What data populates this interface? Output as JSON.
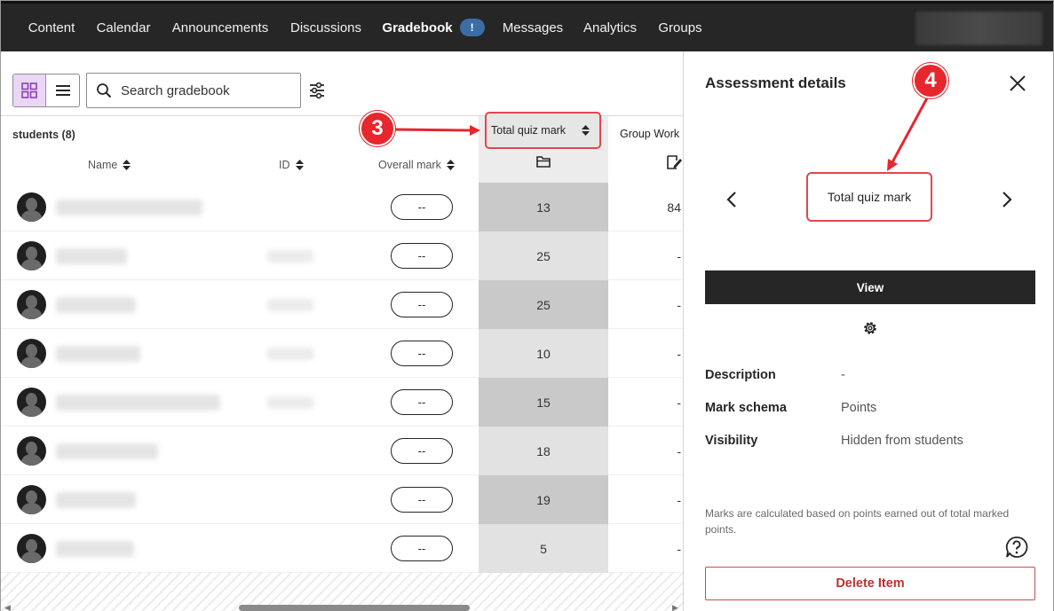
{
  "nav": {
    "tabs": [
      {
        "label": "Content"
      },
      {
        "label": "Calendar"
      },
      {
        "label": "Announcements"
      },
      {
        "label": "Discussions"
      },
      {
        "label": "Gradebook",
        "badge": "!"
      },
      {
        "label": "Messages"
      },
      {
        "label": "Analytics"
      },
      {
        "label": "Groups"
      }
    ],
    "active": "Gradebook"
  },
  "toolbar": {
    "search_placeholder": "Search gradebook"
  },
  "grid": {
    "students_label": "students (8)",
    "columns": {
      "name": "Name",
      "id": "ID",
      "overall": "Overall mark",
      "quiz": "Total quiz mark",
      "group": "Group Work"
    },
    "rows": [
      {
        "overall": "--",
        "quiz": "13",
        "group": "84"
      },
      {
        "overall": "--",
        "quiz": "25",
        "group": "-"
      },
      {
        "overall": "--",
        "quiz": "25",
        "group": "-"
      },
      {
        "overall": "--",
        "quiz": "10",
        "group": "-"
      },
      {
        "overall": "--",
        "quiz": "15",
        "group": "-"
      },
      {
        "overall": "--",
        "quiz": "18",
        "group": "-"
      },
      {
        "overall": "--",
        "quiz": "19",
        "group": "-"
      },
      {
        "overall": "--",
        "quiz": "5",
        "group": "-"
      }
    ]
  },
  "panel": {
    "title": "Assessment details",
    "item_name": "Total quiz mark",
    "view_label": "View",
    "details": [
      {
        "label": "Description",
        "value": "-"
      },
      {
        "label": "Mark schema",
        "value": "Points"
      },
      {
        "label": "Visibility",
        "value": "Hidden from students"
      }
    ],
    "note": "Marks are calculated based on points earned out of total marked points.",
    "delete_label": "Delete Item"
  },
  "callouts": {
    "three": "3",
    "four": "4"
  },
  "colors": {
    "nav_bg": "#262626",
    "accent": "#3b7fc4",
    "callout": "#e8262d",
    "danger": "#b83232"
  }
}
